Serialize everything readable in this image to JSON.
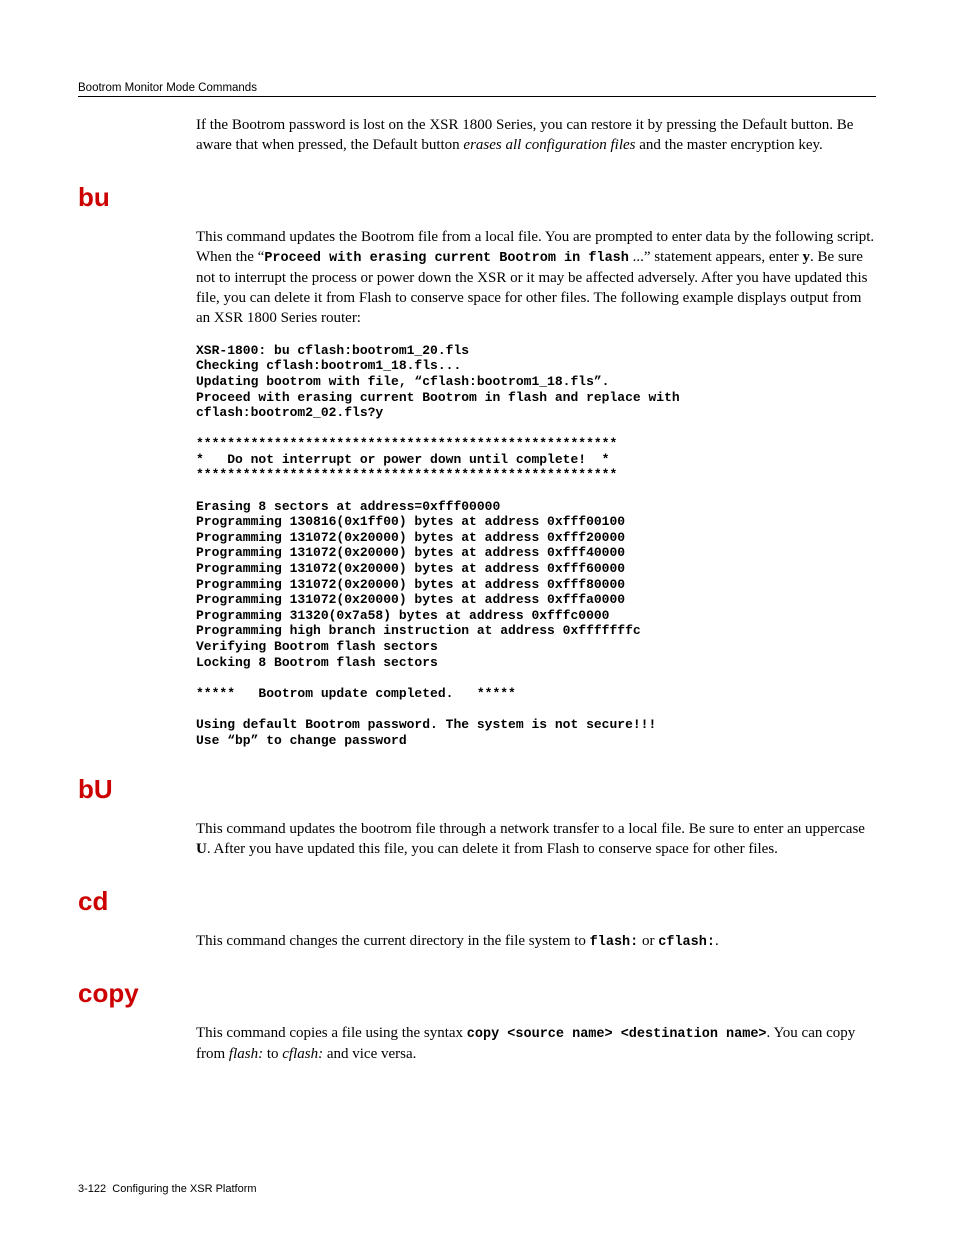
{
  "running_head": "Bootrom Monitor Mode Commands",
  "intro_para": {
    "pre": "If the Bootrom password is lost on the XSR 1800 Series, you can restore it by pressing the Default button. Be aware that when pressed, the Default button ",
    "italic": "erases all configuration files",
    "post": " and the master encryption key."
  },
  "sections": {
    "bu": {
      "heading": "bu",
      "p1": {
        "t1": "This command updates the Bootrom file from a local file. You are prompted to enter data by the following script. When the “",
        "c1": "Proceed with erasing current Bootrom in flash",
        "t2": " ...” statement appears, enter ",
        "b1": "y",
        "t3": ". Be sure not to interrupt the process or power down the XSR or it may be affected adversely. After you have updated this file, you can delete it from Flash to conserve space for other files. The following example displays output from an XSR 1800 Series router:"
      },
      "code": "XSR-1800: bu cflash:bootrom1_20.fls\nChecking cflash:bootrom1_18.fls...\nUpdating bootrom with file, “cflash:bootrom1_18.fls”.\nProceed with erasing current Bootrom in flash and replace with\ncflash:bootrom2_02.fls?y\n\n******************************************************\n*   Do not interrupt or power down until complete!  *\n******************************************************\n\nErasing 8 sectors at address=0xfff00000\nProgramming 130816(0x1ff00) bytes at address 0xfff00100\nProgramming 131072(0x20000) bytes at address 0xfff20000\nProgramming 131072(0x20000) bytes at address 0xfff40000\nProgramming 131072(0x20000) bytes at address 0xfff60000\nProgramming 131072(0x20000) bytes at address 0xfff80000\nProgramming 131072(0x20000) bytes at address 0xfffa0000\nProgramming 31320(0x7a58) bytes at address 0xfffc0000\nProgramming high branch instruction at address 0xfffffffc\nVerifying Bootrom flash sectors\nLocking 8 Bootrom flash sectors\n\n*****   Bootrom update completed.   *****\n\nUsing default Bootrom password. The system is not secure!!!\nUse “bp” to change password"
    },
    "bU": {
      "heading": "bU",
      "p1": {
        "t1": "This command updates the bootrom file through a network transfer to a local file. Be sure to enter an uppercase ",
        "b1": "U",
        "t2": ". After you have updated this file, you can delete it from Flash to conserve space for other files."
      }
    },
    "cd": {
      "heading": "cd",
      "p1": {
        "t1": "This command changes the current directory in the file system to ",
        "c1": "flash:",
        "t2": " or ",
        "c2": "cflash:",
        "t3": "."
      }
    },
    "copy": {
      "heading": "copy",
      "p1": {
        "t1": "This command copies a file using the syntax ",
        "c1": "copy <source name> <destination name>",
        "t2": ". You can copy from ",
        "i1": "flash:",
        "t3": " to ",
        "i2": "cflash:",
        "t4": " and vice versa."
      }
    }
  },
  "footer": {
    "page_ref": "3-122",
    "title": "Configuring the XSR Platform"
  }
}
